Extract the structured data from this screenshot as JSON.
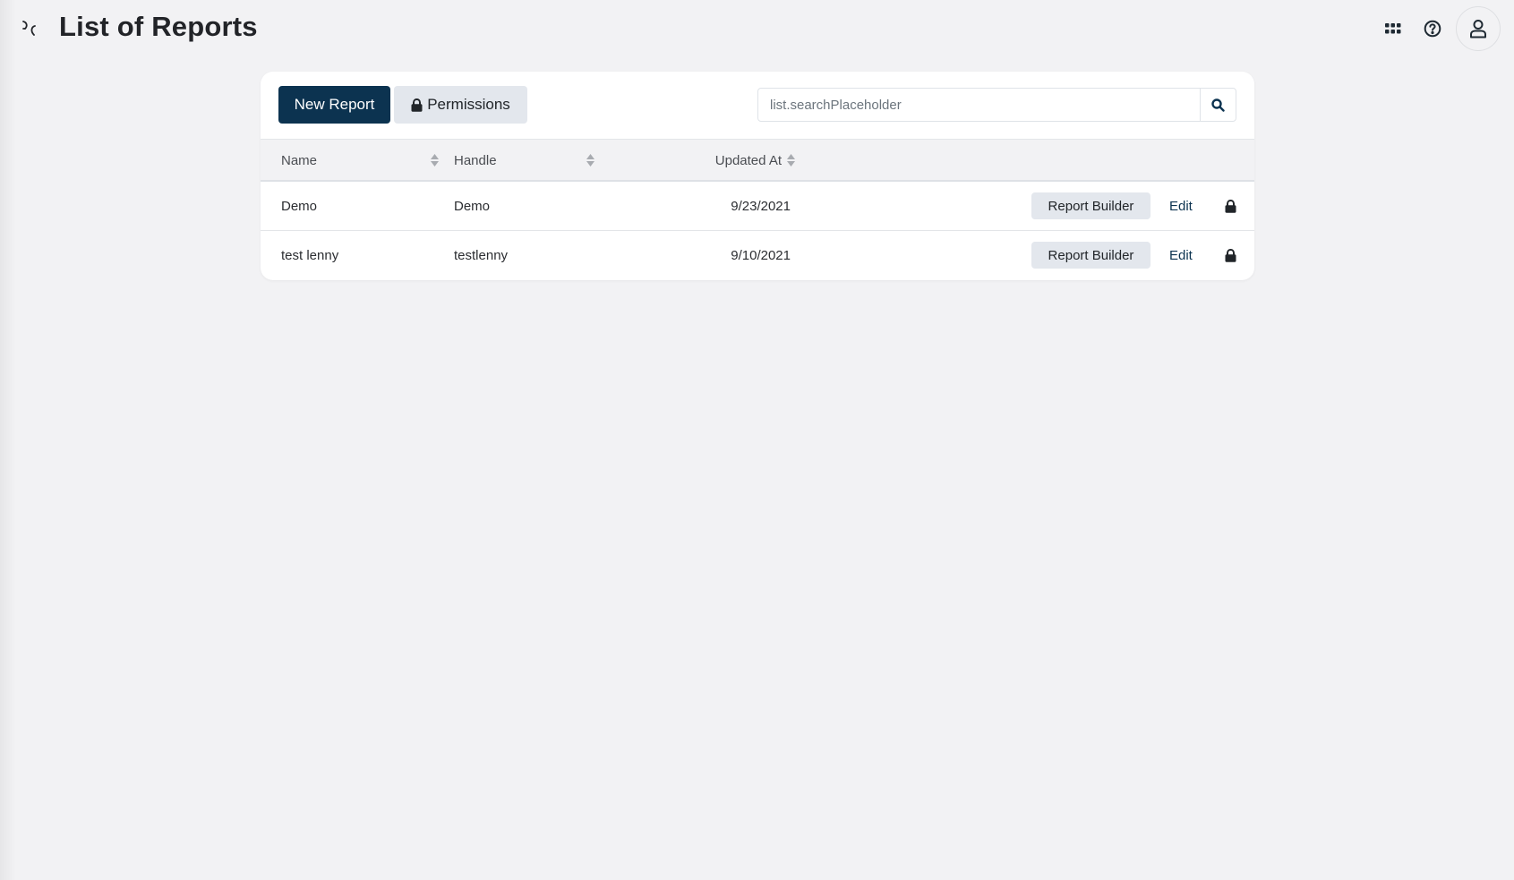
{
  "header": {
    "title": "List of Reports",
    "icons": {
      "sidebar_toggle": "sidebar-toggle-icon",
      "apps": "apps-grid-icon",
      "help": "help-circle-icon",
      "user": "user-icon"
    }
  },
  "toolbar": {
    "new_report_label": "New Report",
    "permissions_label": "Permissions",
    "permissions_icon": "lock-icon",
    "search": {
      "placeholder": "list.searchPlaceholder",
      "value": "",
      "icon": "search-icon"
    }
  },
  "table": {
    "columns": [
      {
        "label": "Name",
        "sortable": true
      },
      {
        "label": "Handle",
        "sortable": true
      },
      {
        "label": "Updated At",
        "sortable": true
      }
    ],
    "rows": [
      {
        "name": "Demo",
        "handle": "Demo",
        "updated_at": "9/23/2021",
        "builder_label": "Report Builder",
        "edit_label": "Edit"
      },
      {
        "name": "test lenny",
        "handle": "testlenny",
        "updated_at": "9/10/2021",
        "builder_label": "Report Builder",
        "edit_label": "Edit"
      }
    ]
  },
  "colors": {
    "primary": "#0c3350",
    "secondary_button": "#e3e7ed",
    "page_background": "#f2f2f4",
    "card_background": "#ffffff"
  }
}
